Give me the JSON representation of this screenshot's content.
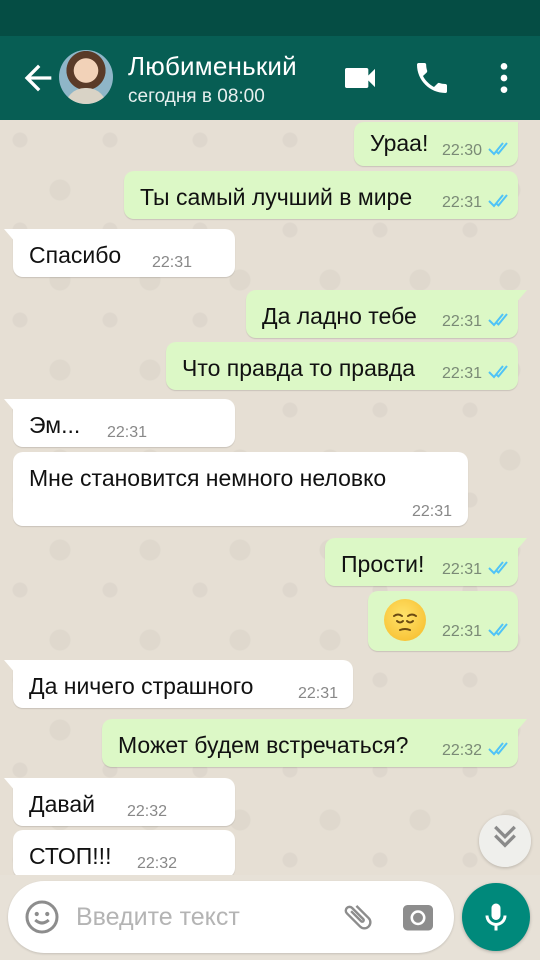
{
  "header": {
    "contact_name": "Любименький",
    "last_seen": "сегодня в 08:00"
  },
  "messages": [
    {
      "dir": "out",
      "text": "Ураа!",
      "time": "22:30",
      "read": true
    },
    {
      "dir": "out",
      "text": "Ты самый лучший в мире",
      "time": "22:31",
      "read": true
    },
    {
      "dir": "in",
      "text": "Спасибо",
      "time": "22:31"
    },
    {
      "dir": "out",
      "text": "Да ладно тебе",
      "time": "22:31",
      "read": true
    },
    {
      "dir": "out",
      "text": "Что правда то правда",
      "time": "22:31",
      "read": true
    },
    {
      "dir": "in",
      "text": "Эм...",
      "time": "22:31"
    },
    {
      "dir": "in",
      "text": "Мне становится немного неловко",
      "time": "22:31"
    },
    {
      "dir": "out",
      "text": "Прости!",
      "time": "22:31",
      "read": true
    },
    {
      "dir": "out",
      "emoji": "pensive-face-icon",
      "time": "22:31",
      "read": true
    },
    {
      "dir": "in",
      "text": "Да ничего страшного",
      "time": "22:31"
    },
    {
      "dir": "out",
      "text": "Может будем встречаться?",
      "time": "22:32",
      "read": true
    },
    {
      "dir": "in",
      "text": "Давай",
      "time": "22:32"
    },
    {
      "dir": "in",
      "text": "СТОП!!!",
      "time": "22:32"
    }
  ],
  "composer": {
    "placeholder": "Введите текст"
  },
  "colors": {
    "header": "#075e54",
    "status_bar": "#054d44",
    "outgoing_bubble": "#dcf8c6",
    "incoming_bubble": "#ffffff",
    "read_ticks": "#4fc3f7",
    "mic_button": "#00897b"
  },
  "icons": [
    "back-arrow-icon",
    "video-call-icon",
    "phone-icon",
    "more-vert-icon",
    "emoji-icon",
    "attach-icon",
    "camera-icon",
    "mic-icon",
    "scroll-down-icon"
  ]
}
